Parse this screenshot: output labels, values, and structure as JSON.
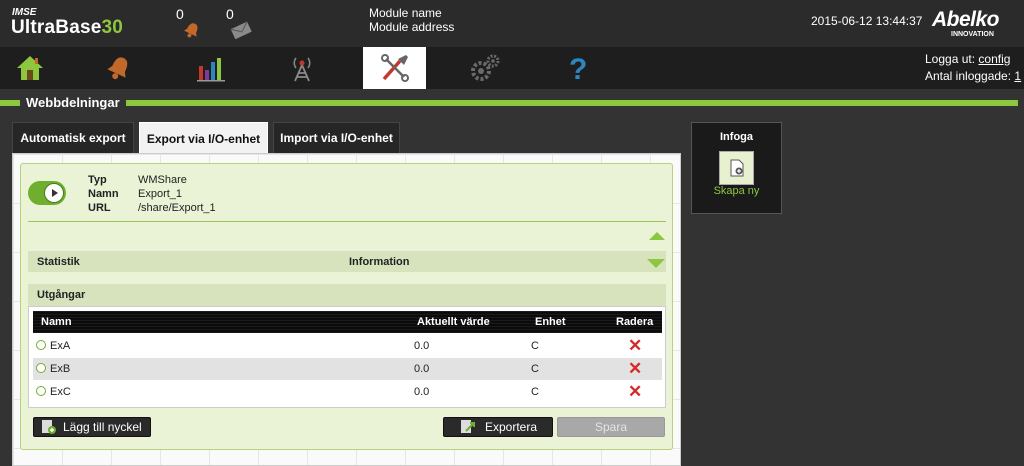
{
  "header": {
    "brand_small": "IMSE",
    "brand_name": "UltraBase",
    "brand_num": "30",
    "alarm_count": "0",
    "message_count": "0",
    "module_name": "Module name",
    "module_address": "Module address",
    "datetime": "2015-06-12 13:44:37",
    "logo": "Abelko",
    "logo_sub": "INNOVATION"
  },
  "nav": {
    "items": [
      "home-icon",
      "alarm-bell-icon",
      "bar-chart-icon",
      "antenna-icon",
      "tools-icon",
      "gears-icon",
      "help-icon"
    ],
    "active": "tools-icon",
    "logout_label": "Logga ut:",
    "logout_user": "config",
    "logged_in_label": "Antal inloggade:",
    "logged_in_count": "1"
  },
  "section": {
    "title": "Webbdelningar"
  },
  "tabs": [
    {
      "label": "Automatisk export",
      "active": false
    },
    {
      "label": "Export via I/O-enhet",
      "active": true
    },
    {
      "label": "Import via I/O-enhet",
      "active": false
    }
  ],
  "export": {
    "type_label": "Typ",
    "type_value": "WMShare",
    "name_label": "Namn",
    "name_value": "Export_1",
    "url_label": "URL",
    "url_value": "/share/Export_1",
    "statistics_label": "Statistik",
    "information_label": "Information",
    "outputs_label": "Utgångar"
  },
  "table": {
    "headers": {
      "name": "Namn",
      "value": "Aktuellt värde",
      "unit": "Enhet",
      "delete": "Radera"
    },
    "rows": [
      {
        "name": "ExA",
        "value": "0.0",
        "unit": "C"
      },
      {
        "name": "ExB",
        "value": "0.0",
        "unit": "C"
      },
      {
        "name": "ExC",
        "value": "0.0",
        "unit": "C"
      }
    ]
  },
  "buttons": {
    "add_key": "Lägg till nyckel",
    "export": "Exportera",
    "save": "Spara"
  },
  "side": {
    "title": "Infoga",
    "create_new": "Skapa ny"
  },
  "colors": {
    "accent": "#8dc63f",
    "delete": "#d42a2a"
  }
}
